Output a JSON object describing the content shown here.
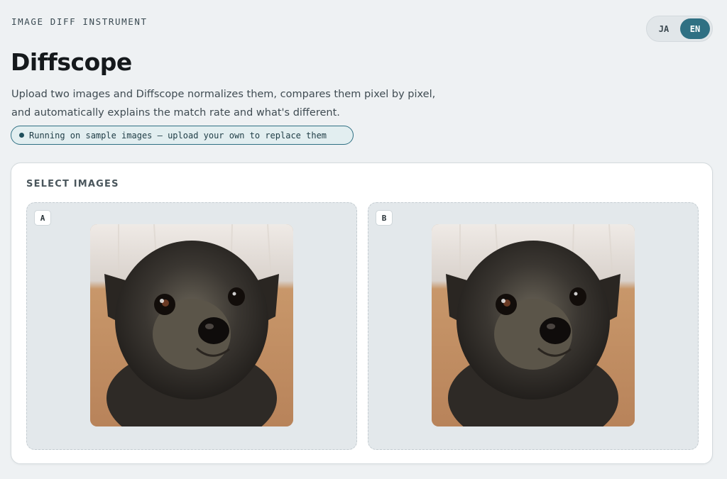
{
  "header": {
    "eyebrow": "IMAGE DIFF INSTRUMENT",
    "title": "Diffscope",
    "description_line1": "Upload two images and Diffscope normalizes them, compares them pixel by pixel,",
    "description_line2": "and automatically explains the match rate and what's different."
  },
  "language": {
    "options": [
      "JA",
      "EN"
    ],
    "selected": "EN"
  },
  "status_pill": {
    "text": "Running on sample images — upload your own to replace them"
  },
  "select_card": {
    "title": "SELECT IMAGES",
    "slots": [
      {
        "label": "A",
        "image_icon": "dog-photo"
      },
      {
        "label": "B",
        "image_icon": "dog-photo"
      }
    ]
  },
  "colors": {
    "accent": "#2f7083",
    "background": "#eef1f3",
    "card": "#ffffff",
    "slot_background": "#e3e8eb"
  }
}
